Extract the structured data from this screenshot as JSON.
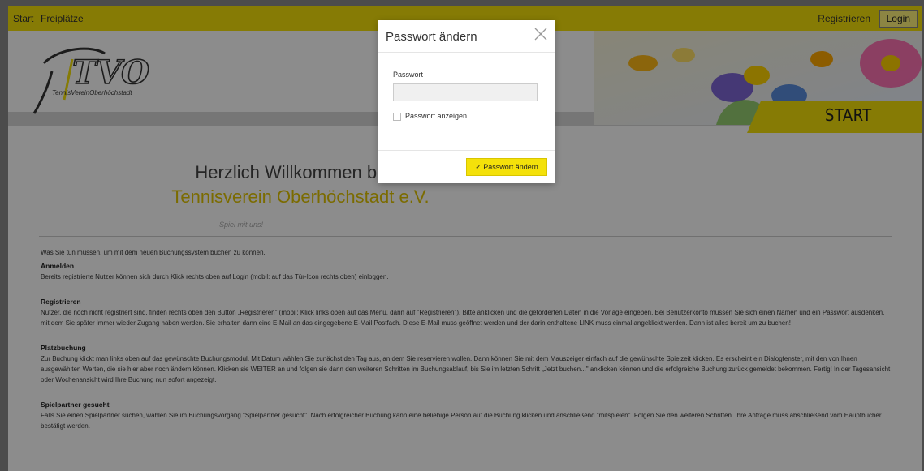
{
  "nav": {
    "start": "Start",
    "freiplaetze": "Freiplätze",
    "registrieren": "Registrieren",
    "login": "Login"
  },
  "logo": {
    "text": "TVO",
    "subtitle": "TennisVereinOberhöchstadt"
  },
  "banner": {
    "tab_label": "START"
  },
  "welcome": {
    "line1": "Herzlich Willkommen beim",
    "line2": "Tennisverein Oberhöchstadt e.V.",
    "slogan": "Spiel mit uns!"
  },
  "content": {
    "intro": "Was Sie tun müssen, um mit dem neuen Buchungssystem buchen zu können.",
    "sections": [
      {
        "heading": "Anmelden",
        "text": "Bereits registrierte Nutzer können sich durch Klick rechts oben auf Login (mobil: auf das Tür-Icon rechts oben) einloggen."
      },
      {
        "heading": "Registrieren",
        "text": "Nutzer, die noch nicht registriert sind, finden rechts oben den Button „Registrieren\" (mobil: Klick links oben auf das Menü, dann auf \"Registrieren\"). Bitte anklicken und die geforderten Daten in die Vorlage eingeben. Bei Benutzerkonto müssen Sie sich einen Namen und ein Passwort ausdenken, mit dem Sie später immer wieder Zugang haben werden. Sie erhalten dann eine E-Mail an das eingegebene E-Mail Postfach. Diese E-Mail muss geöffnet werden und der darin enthaltene LINK muss einmal angeklickt werden. Dann ist alles bereit um zu buchen!"
      },
      {
        "heading": "Platzbuchung",
        "text": "Zur Buchung klickt man links oben auf das gewünschte Buchungsmodul. Mit Datum wählen Sie zunächst den Tag aus, an dem Sie reservieren wollen. Dann können Sie mit dem Mauszeiger einfach auf die gewünschte Spielzeit klicken. Es erscheint ein Dialogfenster, mit den von Ihnen ausgewählten Werten, die sie hier aber noch ändern können. Klicken sie WEITER an und folgen sie dann den weiteren Schritten im Buchungsablauf, bis Sie im letzten Schritt „Jetzt buchen...\" anklicken können und die erfolgreiche Buchung zurück gemeldet bekommen. Fertig! In der Tagesansicht oder Wochenansicht wird Ihre Buchung nun sofort angezeigt."
      },
      {
        "heading": "Spielpartner gesucht",
        "text": "Falls Sie einen Spielpartner suchen, wählen Sie im Buchungsvorgang \"Spielpartner gesucht\". Nach erfolgreicher Buchung kann eine beliebige Person auf die Buchung klicken und anschließend \"mitspielen\". Folgen Sie den weiteren Schritten. Ihre Anfrage muss abschließend vom Hauptbucher bestätigt werden."
      }
    ]
  },
  "modal": {
    "title": "Passwort ändern",
    "field_label": "Passwort",
    "field_value": "",
    "show_password_label": "Passwort anzeigen",
    "show_password_checked": false,
    "submit_label": "Passwort ändern"
  },
  "colors": {
    "accent": "#f4e10a",
    "overlay": "rgba(0,0,0,0.45)"
  }
}
